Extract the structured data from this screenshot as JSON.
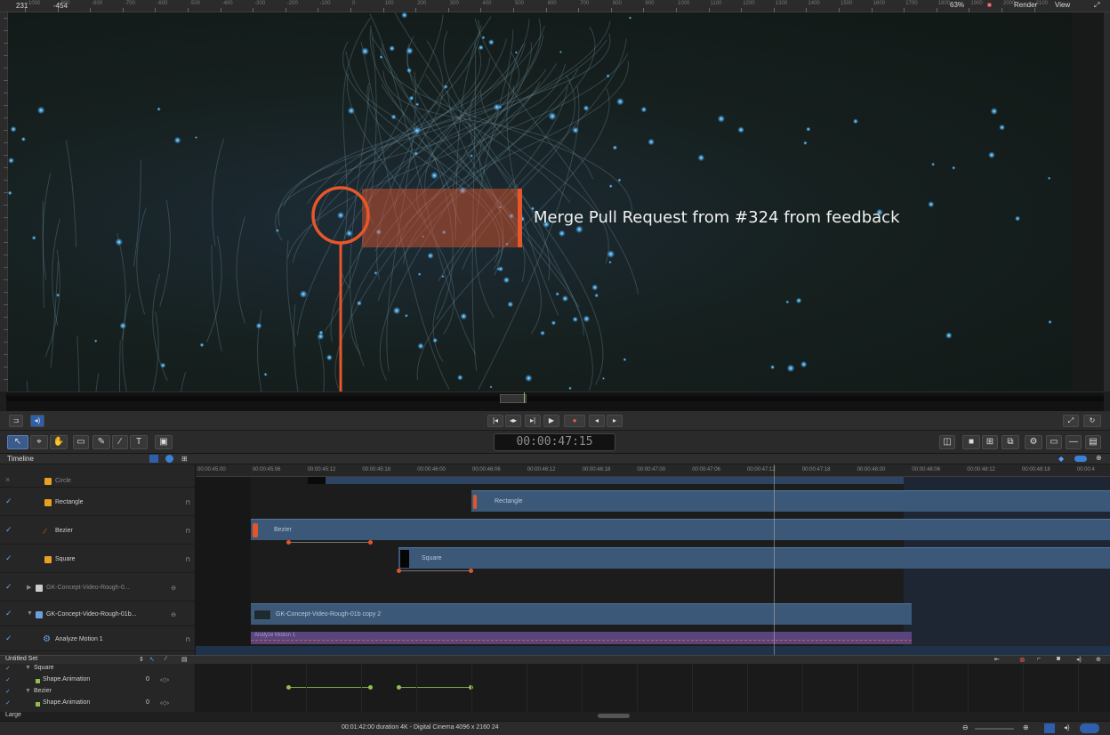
{
  "ruler": {
    "x_coord": "231",
    "y_coord": "-454",
    "zoom": "63%",
    "render_label": "Render",
    "view_label": "View",
    "tick_labels": [
      "-1000",
      "-900",
      "-800",
      "-700",
      "-600",
      "-500",
      "-400",
      "-300",
      "-200",
      "-100",
      "0",
      "100",
      "200",
      "300",
      "400",
      "500",
      "600",
      "700",
      "800",
      "900",
      "1000",
      "1100",
      "1200",
      "1300",
      "1400",
      "1500",
      "1600",
      "1700",
      "1800",
      "1900",
      "2000",
      "2100"
    ]
  },
  "canvas": {
    "callout_text": "Merge Pull Request from #324 from feedback",
    "accent_color": "#e8562b"
  },
  "transport": {
    "timecode": "00:00:47:15"
  },
  "timeline": {
    "title": "Timeline",
    "ruler_labels": [
      "00:00:45:00",
      "00:00:45:06",
      "00:00:45:12",
      "00:00:45:18",
      "00:00:46:00",
      "00:00:46:06",
      "00:00:46:12",
      "00:00:46:18",
      "00:00:47:00",
      "00:00:47:06",
      "00:00:47:12",
      "00:00:47:18",
      "00:00:48:00",
      "00:00:48:06",
      "00:00:48:12",
      "00:00:48:18",
      "00:00:4"
    ],
    "layers": [
      {
        "name": "Circle",
        "icon": "circle-shape-icon",
        "color": "#e8a020"
      },
      {
        "name": "Rectangle",
        "icon": "rectangle-shape-icon",
        "color": "#e8a020"
      },
      {
        "name": "Bezier",
        "icon": "bezier-shape-icon",
        "color": "#e8562b"
      },
      {
        "name": "Square",
        "icon": "square-shape-icon",
        "color": "#e8a020"
      },
      {
        "name": "GK-Concept-Video-Rough-0...",
        "icon": "video-clip-icon",
        "color": "#cccccc"
      },
      {
        "name": "GK-Concept-Video-Rough-01b...",
        "icon": "video-clip-icon",
        "color": "#6aa0e0"
      },
      {
        "name": "Analyze Motion 1",
        "icon": "behavior-gear-icon",
        "color": "#6aa0e0"
      }
    ],
    "clips": {
      "rectangle": "Rectangle",
      "bezier": "Bezier",
      "square": "Square",
      "video": "GK-Concept-Video-Rough-01b copy 2",
      "analyze": "Analyze Motion 1"
    }
  },
  "keyframes": {
    "set_name": "Untitled Set",
    "rows": [
      {
        "label": "Square",
        "value": ""
      },
      {
        "label": "Shape.Animation",
        "value": "0"
      },
      {
        "label": "Bezier",
        "value": ""
      },
      {
        "label": "Shape.Animation",
        "value": "0"
      }
    ],
    "size_option": "Large"
  },
  "status": {
    "info": "00:01:42:00 duration 4K - Digital Cinema 4096 x 2160 24"
  }
}
